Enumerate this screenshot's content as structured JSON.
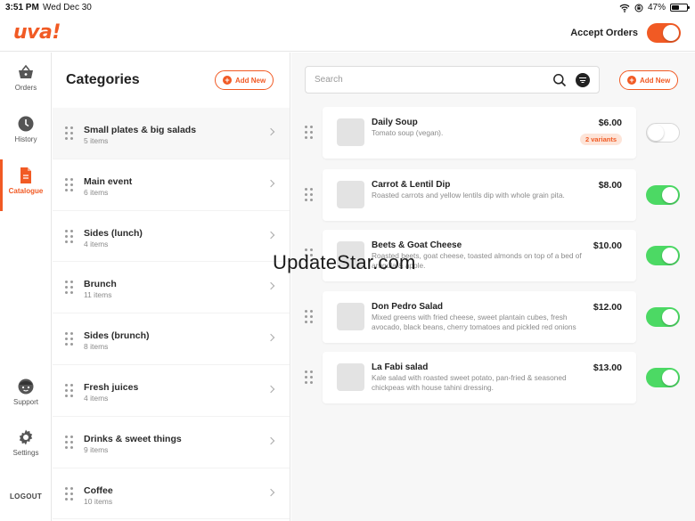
{
  "status_bar": {
    "time": "3:51 PM",
    "date": "Wed Dec 30",
    "battery": "47%",
    "battery_level": 0.47
  },
  "header": {
    "logo": "uva!",
    "accept_orders_label": "Accept Orders",
    "accept_orders_on": true
  },
  "nav": {
    "items": [
      {
        "label": "Orders",
        "icon": "basket-icon"
      },
      {
        "label": "History",
        "icon": "clock-icon"
      },
      {
        "label": "Catalogue",
        "icon": "document-icon",
        "active": true
      },
      {
        "label": "Support",
        "icon": "support-face-icon"
      },
      {
        "label": "Settings",
        "icon": "gear-icon"
      }
    ],
    "logout": "LOGOUT"
  },
  "categories": {
    "title": "Categories",
    "add_label": "Add New",
    "items": [
      {
        "name": "Small plates & big salads",
        "count": "5 items"
      },
      {
        "name": "Main event",
        "count": "6 items"
      },
      {
        "name": "Sides (lunch)",
        "count": "4 items"
      },
      {
        "name": "Brunch",
        "count": "11 items"
      },
      {
        "name": "Sides (brunch)",
        "count": "8 items"
      },
      {
        "name": "Fresh juices",
        "count": "4 items"
      },
      {
        "name": "Drinks & sweet things",
        "count": "9 items"
      },
      {
        "name": "Coffee",
        "count": "10 items"
      }
    ]
  },
  "main": {
    "search_placeholder": "Search",
    "add_label": "Add New",
    "items": [
      {
        "name": "Daily Soup",
        "desc": "Tomato soup (vegan).",
        "price": "$6.00",
        "badge": "2 variants",
        "enabled": false
      },
      {
        "name": "Carrot & Lentil Dip",
        "desc": "Roasted carrots and yellow lentils dip with whole grain pita.",
        "price": "$8.00",
        "enabled": true
      },
      {
        "name": "Beets & Goat Cheese",
        "desc": "Roasted beets, goat cheese, toasted almonds on top of a bed of arugula & apple.",
        "price": "$10.00",
        "enabled": true
      },
      {
        "name": "Don Pedro Salad",
        "desc": "Mixed greens with fried cheese, sweet plantain cubes, fresh avocado, black beans, cherry tomatoes and pickled red onions with house rec...",
        "price": "$12.00",
        "enabled": true
      },
      {
        "name": "La Fabi salad",
        "desc": "Kale salad with roasted sweet potato, pan-fried & seasoned chickpeas with house tahini dressing.",
        "price": "$13.00",
        "enabled": true
      }
    ]
  },
  "watermark": "UpdateStar.com",
  "colors": {
    "accent": "#f15a24",
    "toggle_on": "#4cd964"
  }
}
